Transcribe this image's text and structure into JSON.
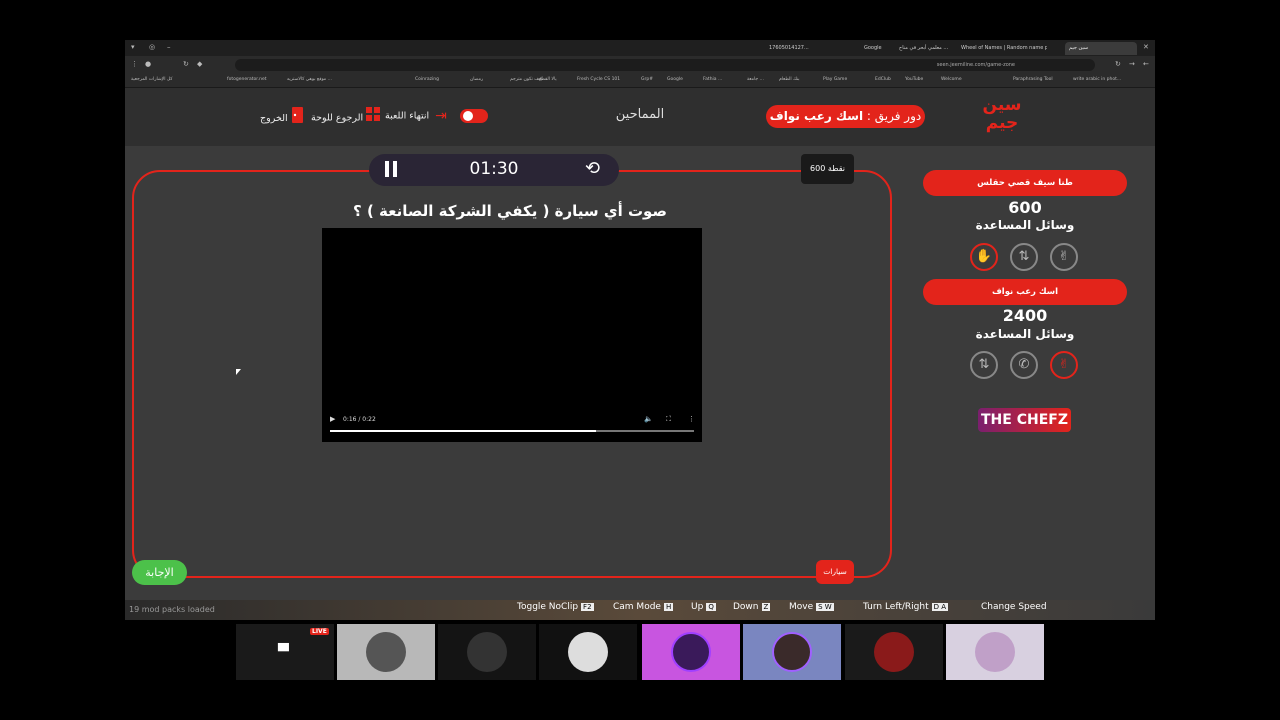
{
  "browser": {
    "tabs": [
      "17605014127...",
      "Google",
      "معلمي أبحر في مناح ...",
      "Wheel of Names | Random name picker",
      "سين جيم"
    ],
    "address": "seen.jeemiline.com/game-zone",
    "bookmarks": [
      "كل الإشارات المرجعية",
      "fotogenerator.net",
      "موقع بوهي كالاستريه ...",
      "Coinrazing",
      "رمضان",
      "كيف تكون مترجم ...",
      "يالا القطع",
      "Fresh Cycle CS 101",
      "Grp#",
      "Google",
      "Fathia ...",
      "جامعة ...",
      "بنك الطعام",
      "Play Game",
      "EdClub",
      "YouTube",
      "Welcome",
      "Paraphrasing Tool",
      "write arabic in phot..."
    ]
  },
  "header": {
    "logo_text": "سين جيم",
    "turn_prefix": "دور فريق :",
    "turn_team": "اسك رعب نواف",
    "competitors": "المماحين",
    "end_game": "انتهاء اللعبة",
    "back_to_board": "الرجوع للوحة",
    "exit": "الخروج"
  },
  "question": {
    "timer": "01:30",
    "points": "600 نقطة",
    "text": "صوت أي سيارة ( يكفي الشركة الصانعة ) ؟",
    "video_time": "0:16 / 0:22",
    "video_progress": 0.73,
    "answer_button": "الإجابة",
    "category": "سيارات"
  },
  "teams": [
    {
      "name": "طنا سيف قصي حقلس",
      "score": "600",
      "aids_label": "وسائل المساعدة"
    },
    {
      "name": "اسك رعب نواف",
      "score": "2400",
      "aids_label": "وسائل المساعدة"
    }
  ],
  "sponsor": "THE CHEFZ",
  "overlay": {
    "mods": "19 mod packs loaded",
    "controls": [
      {
        "label": "Toggle NoClip",
        "key": "F2"
      },
      {
        "label": "Cam Mode",
        "key": "H"
      },
      {
        "label": "Up",
        "key": "Q"
      },
      {
        "label": "Down",
        "key": "Z"
      },
      {
        "label": "Move",
        "key": "S W"
      },
      {
        "label": "Turn Left/Right",
        "key": "D A"
      },
      {
        "label": "Change Speed",
        "key": ""
      }
    ]
  },
  "participants": {
    "live": "LIVE"
  },
  "colors": {
    "accent": "#e3241b",
    "answer": "#4cc14a",
    "background": "#3b3b3b"
  }
}
